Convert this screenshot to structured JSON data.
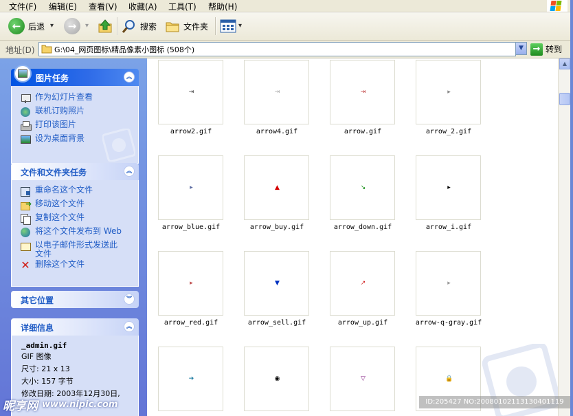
{
  "menu": {
    "file": "文件(F)",
    "edit": "编辑(E)",
    "view": "查看(V)",
    "favorites": "收藏(A)",
    "tools": "工具(T)",
    "help": "帮助(H)"
  },
  "toolbar": {
    "back": "后退",
    "search": "搜索",
    "folders": "文件夹",
    "dropdown_arrow": "▾"
  },
  "address": {
    "label": "地址(D)",
    "path": "G:\\04_网页图标\\精品像素小图标 (508个)",
    "go": "转到"
  },
  "task_pane": {
    "picture_tasks": {
      "title": "图片任务",
      "items": [
        {
          "label": "作为幻灯片查看",
          "icon": "slideshow-icon"
        },
        {
          "label": "联机订购照片",
          "icon": "order-prints-icon"
        },
        {
          "label": "打印该图片",
          "icon": "printer-icon"
        },
        {
          "label": "设为桌面背景",
          "icon": "desktop-background-icon"
        }
      ]
    },
    "file_tasks": {
      "title": "文件和文件夹任务",
      "items": [
        {
          "label": "重命名这个文件",
          "icon": "rename-icon"
        },
        {
          "label": "移动这个文件",
          "icon": "move-icon"
        },
        {
          "label": "复制这个文件",
          "icon": "copy-icon"
        },
        {
          "label": "将这个文件发布到 Web",
          "icon": "publish-web-icon"
        },
        {
          "label": "以电子邮件形式发送此\n文件",
          "icon": "email-icon"
        },
        {
          "label": "删除这个文件",
          "icon": "delete-icon"
        }
      ]
    },
    "other_places": {
      "title": "其它位置"
    },
    "details": {
      "title": "详细信息",
      "filename": "_admin.gif",
      "type": "GIF 图像",
      "dimensions": "尺寸: 21 x 13",
      "size": "大小: 157 字节",
      "modified": "修改日期: 2003年12月30日,"
    }
  },
  "files": [
    {
      "name": "arrow2.gif",
      "glyph": "⇥",
      "color": "#444444"
    },
    {
      "name": "arrow4.gif",
      "glyph": "⇥",
      "color": "#aaaaaa"
    },
    {
      "name": "arrow.gif",
      "glyph": "⇥",
      "color": "#c04040"
    },
    {
      "name": "arrow_2.gif",
      "glyph": "▸",
      "color": "#888888"
    },
    {
      "name": "arrow_blue.gif",
      "glyph": "▸",
      "color": "#5a6aa0"
    },
    {
      "name": "arrow_buy.gif",
      "glyph": "▲",
      "color": "#d40000"
    },
    {
      "name": "arrow_down.gif",
      "glyph": "↘",
      "color": "#0a8a0a"
    },
    {
      "name": "arrow_i.gif",
      "glyph": "▸",
      "color": "#000000"
    },
    {
      "name": "arrow_red.gif",
      "glyph": "▸",
      "color": "#c05050"
    },
    {
      "name": "arrow_sell.gif",
      "glyph": "▼",
      "color": "#0030c0"
    },
    {
      "name": "arrow_up.gif",
      "glyph": "↗",
      "color": "#d02020"
    },
    {
      "name": "arrow-q-gray.gif",
      "glyph": "▸",
      "color": "#999999"
    },
    {
      "name": "",
      "glyph": "➔",
      "color": "#1a7aa0"
    },
    {
      "name": "",
      "glyph": "◉",
      "color": "#000000"
    },
    {
      "name": "",
      "glyph": "▽",
      "color": "#8a2a8a"
    },
    {
      "name": "",
      "glyph": "🔒",
      "color": "#555555"
    }
  ],
  "watermark": {
    "site": "昵享网",
    "url": "www.nipic.com",
    "id": "ID:205427 NO:20080102113130401119"
  },
  "colors": {
    "pane_top": "#7ba2e7",
    "pane_bottom": "#6375d6",
    "link": "#215dc6",
    "menu_bg": "#ece9d8"
  }
}
